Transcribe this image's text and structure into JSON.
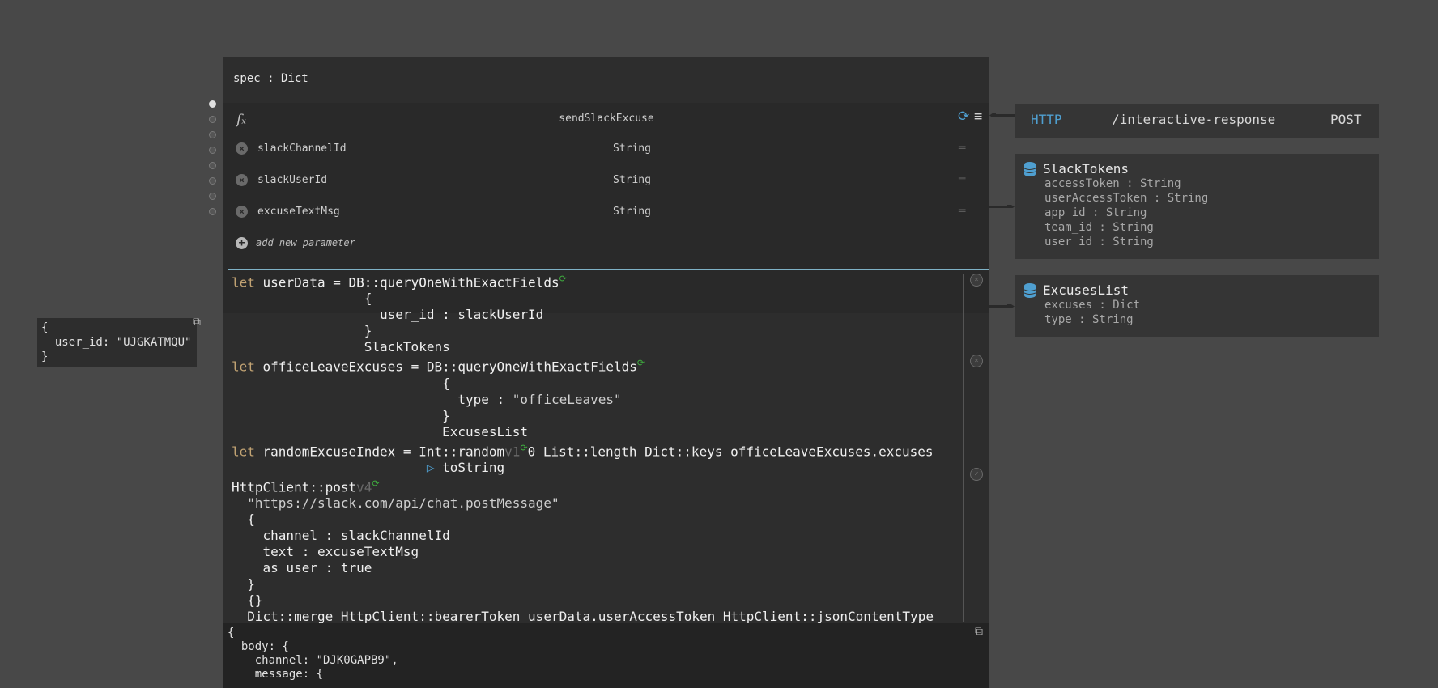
{
  "spec": {
    "label": "spec : Dict"
  },
  "function": {
    "name": "sendSlackExcuse",
    "fx_icon": "fx-icon",
    "params": [
      {
        "name": "slackChannelId",
        "type": "String"
      },
      {
        "name": "slackUserId",
        "type": "String"
      },
      {
        "name": "excuseTextMsg",
        "type": "String"
      }
    ],
    "add_param_label": "add new parameter"
  },
  "code": {
    "l1_kw": "let",
    "l1_rest": " userData = DB::queryOneWithExactFields",
    "l2": "                 {",
    "l3": "                   user_id : slackUserId",
    "l4": "                 }",
    "l5": "                 SlackTokens",
    "l6_kw": "let",
    "l6_rest": " officeLeaveExcuses = DB::queryOneWithExactFields",
    "l7": "                           {",
    "l8a": "                             type : ",
    "l8b": "\"officeLeaves\"",
    "l9": "                           }",
    "l10": "                           ExcusesList",
    "l11_kw": "let",
    "l11_a": " randomExcuseIndex = Int::random",
    "l11_v": "v1",
    "l11_b": "0 List::length Dict::keys officeLeaveExcuses.excuses",
    "l12_pre": "                         ",
    "l12_pipe": "▷",
    "l12_post": " toString",
    "l13a": "HttpClient::post",
    "l13_v": "v4",
    "l14": "  \"https://slack.com/api/chat.postMessage\"",
    "l15": "  {",
    "l16": "    channel : slackChannelId",
    "l17": "    text : excuseTextMsg",
    "l18": "    as_user : true",
    "l19": "  }",
    "l20": "  {}",
    "l21": "  Dict::merge HttpClient::bearerToken userData.userAccessToken HttpClient::jsonContentType"
  },
  "result": {
    "text": "{\n  body: {\n    channel: \"DJK0GAPB9\",\n    message: {"
  },
  "input_trace": {
    "text": "{\n  user_id: \"UJGKATMQU\"\n}"
  },
  "http_handler": {
    "method_label": "HTTP",
    "path": "/interactive-response",
    "verb": "POST"
  },
  "datastores": [
    {
      "name": "SlackTokens",
      "fields": [
        "accessToken : String",
        "userAccessToken : String",
        "app_id : String",
        "team_id : String",
        "user_id : String"
      ]
    },
    {
      "name": "ExcusesList",
      "fields": [
        "excuses : Dict",
        "type : String"
      ]
    }
  ],
  "colors": {
    "background": "#484848",
    "panel": "#2d2d2d",
    "keyword": "#c2a373",
    "accent_blue": "#4f9fd0",
    "refresh_green": "#3fae3f"
  }
}
